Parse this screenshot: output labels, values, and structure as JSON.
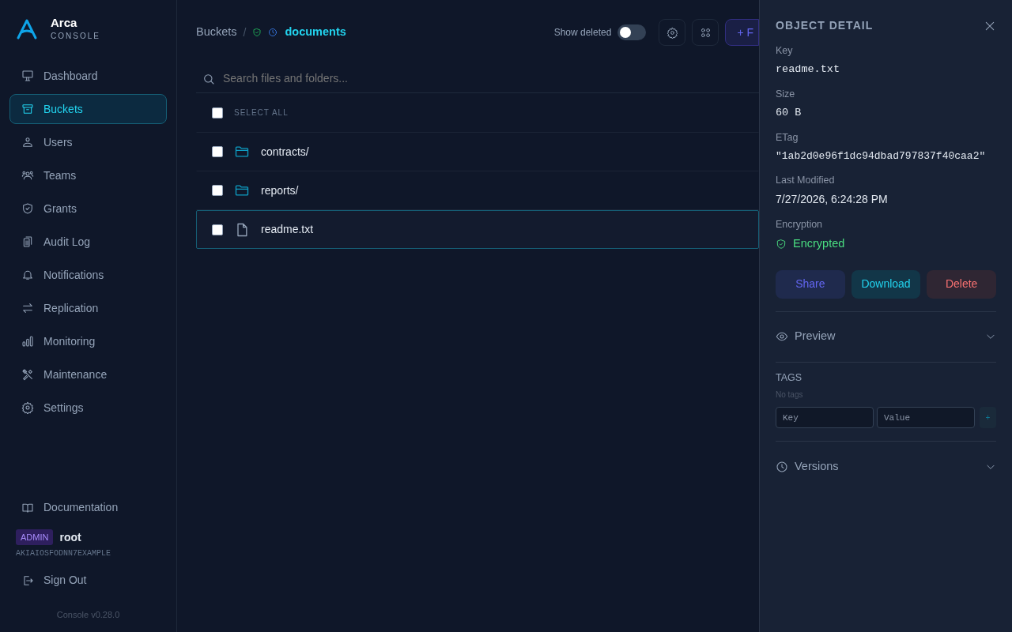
{
  "brand": {
    "name": "Arca",
    "subtitle": "CONSOLE"
  },
  "nav": [
    {
      "label": "Dashboard",
      "selected": false
    },
    {
      "label": "Buckets",
      "selected": true
    },
    {
      "label": "Users",
      "selected": false
    },
    {
      "label": "Teams",
      "selected": false
    },
    {
      "label": "Grants",
      "selected": false
    },
    {
      "label": "Audit Log",
      "selected": false
    },
    {
      "label": "Notifications",
      "selected": false
    },
    {
      "label": "Replication",
      "selected": false
    },
    {
      "label": "Monitoring",
      "selected": false
    },
    {
      "label": "Maintenance",
      "selected": false
    },
    {
      "label": "Settings",
      "selected": false
    }
  ],
  "sidebar_footer": {
    "documentation": "Documentation",
    "role_badge": "ADMIN",
    "user": "root",
    "access_key": "AKIAIOSFODNN7EXAMPLE",
    "sign_out": "Sign Out",
    "version": "Console v0.28.0"
  },
  "breadcrumb": {
    "root": "Buckets",
    "separator": "/",
    "bucket": "documents"
  },
  "toolbar": {
    "show_deleted": {
      "label": "Show deleted",
      "on": false
    },
    "new_folder_button": "+ F"
  },
  "search": {
    "placeholder": "Search files and folders..."
  },
  "list": {
    "select_all": {
      "label": "SELECT ALL",
      "checked": false
    },
    "rows": [
      {
        "name": "contracts/",
        "kind": "folder",
        "checked": false,
        "selected": false
      },
      {
        "name": "reports/",
        "kind": "folder",
        "checked": false,
        "selected": false
      },
      {
        "name": "readme.txt",
        "kind": "file",
        "checked": false,
        "selected": true
      }
    ]
  },
  "detail": {
    "title": "OBJECT DETAIL",
    "fields": [
      {
        "label": "Key",
        "value": "readme.txt",
        "kind": "mono"
      },
      {
        "label": "Size",
        "value": "60 B",
        "kind": "mono"
      },
      {
        "label": "ETag",
        "value": "\"1ab2d0e96f1dc94dbad797837f40caa2\"",
        "kind": "mono"
      },
      {
        "label": "Last Modified",
        "value": "7/27/2026, 6:24:28 PM",
        "kind": "text"
      },
      {
        "label": "Encryption",
        "value": "Encrypted",
        "kind": "status"
      }
    ],
    "actions": [
      {
        "label": "Share",
        "kind": "share"
      },
      {
        "label": "Download",
        "kind": "download"
      },
      {
        "label": "Delete",
        "kind": "delete"
      }
    ],
    "preview": {
      "label": "Preview",
      "expanded": false
    },
    "tags": {
      "title": "TAGS",
      "empty": "No tags",
      "key_placeholder": "Key",
      "value_placeholder": "Value",
      "add": "+"
    },
    "versions": {
      "label": "Versions",
      "expanded": false
    }
  }
}
